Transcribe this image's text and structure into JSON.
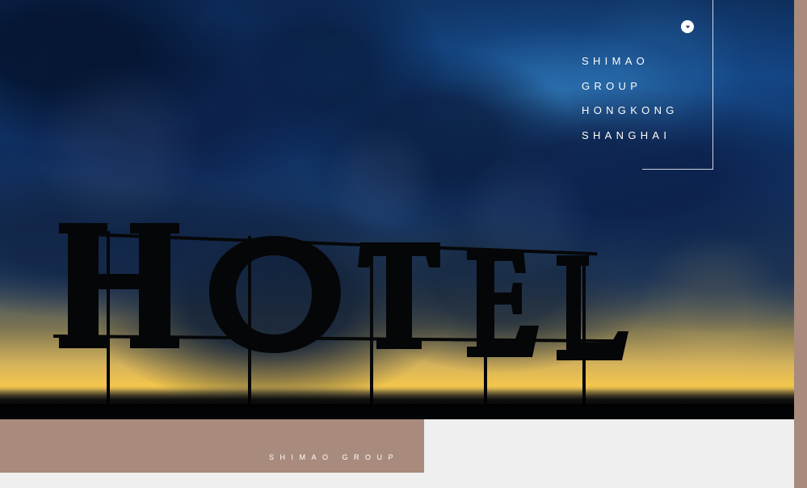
{
  "hero": {
    "sign_text": "HOTEL"
  },
  "overlay": {
    "icon": "chevron-down-icon",
    "lines": [
      "SHIMAO",
      "GROUP",
      "HONGKONG",
      "SHANGHAI"
    ]
  },
  "footer": {
    "label": "SHIMAO GROUP"
  },
  "colors": {
    "accent": "#a88b7c",
    "background": "#efefef",
    "overlay_text": "#ffffff"
  }
}
